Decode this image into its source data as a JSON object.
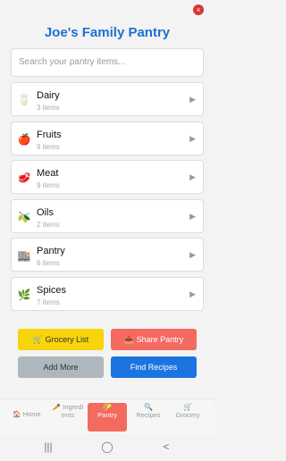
{
  "title": "Joe's Family Pantry",
  "search": {
    "placeholder": "Search your pantry items..."
  },
  "categories": [
    {
      "icon": "glass-icon",
      "name": "Dairy",
      "count": "3 items"
    },
    {
      "icon": "apple-icon",
      "name": "Fruits",
      "count": "9 items"
    },
    {
      "icon": "meat-icon",
      "name": "Meat",
      "count": "9 items"
    },
    {
      "icon": "olive-icon",
      "name": "Oils",
      "count": "2 items"
    },
    {
      "icon": "pantry-icon",
      "name": "Pantry",
      "count": "6 items"
    },
    {
      "icon": "herb-icon",
      "name": "Spices",
      "count": "7 items"
    }
  ],
  "actions": {
    "grocery_list": "Grocery List",
    "share_pantry": "Share Pantry",
    "add_more": "Add More",
    "find_recipes": "Find Recipes"
  },
  "nav": {
    "home": "Home",
    "ingredients": "Ingredi ents",
    "pantry": "Pantry",
    "recipes": "Recipes",
    "grocery": "Grocery"
  }
}
